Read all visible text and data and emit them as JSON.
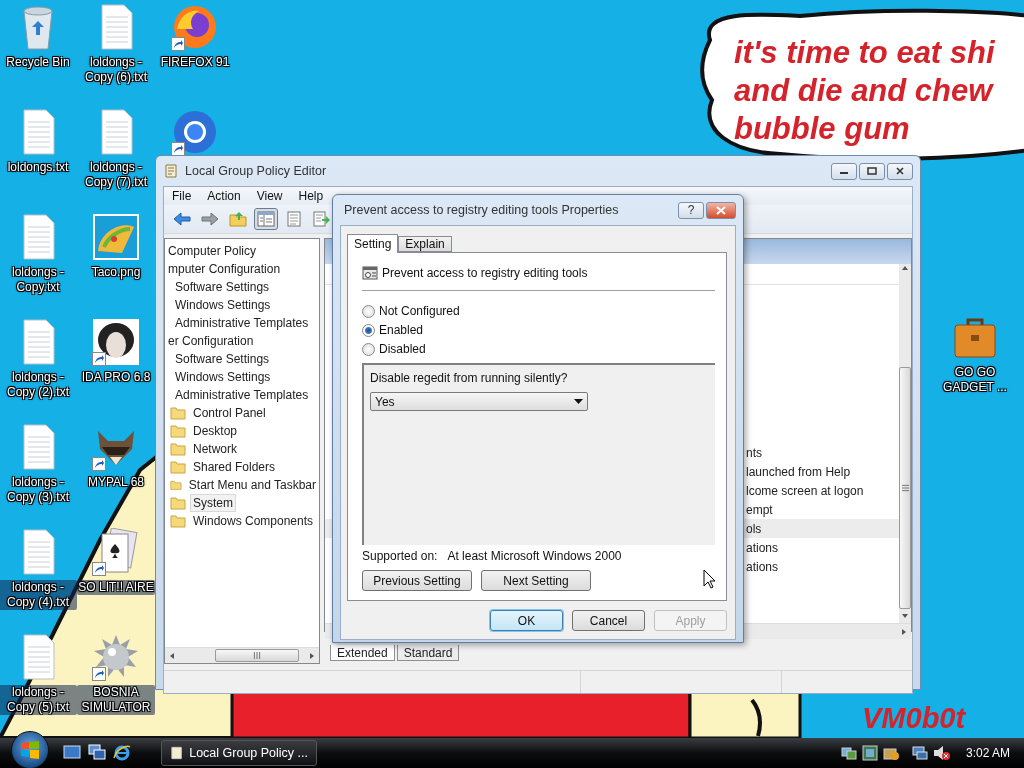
{
  "desktop_icons": [
    {
      "label": "Recycle Bin",
      "kind": "recycle",
      "shortcut": false
    },
    {
      "label": "loldongs.txt",
      "kind": "text",
      "shortcut": false
    },
    {
      "label": "loldongs - Copy.txt",
      "kind": "text",
      "shortcut": false
    },
    {
      "label": "loldongs - Copy (2).txt",
      "kind": "text",
      "shortcut": false
    },
    {
      "label": "loldongs - Copy (3).txt",
      "kind": "text",
      "shortcut": false
    },
    {
      "label": "loldongs - Copy (4).txt",
      "kind": "text",
      "shortcut": false
    },
    {
      "label": "loldongs - Copy (5).txt",
      "kind": "text",
      "shortcut": false
    },
    {
      "label": "loldongs - Copy (6).txt",
      "kind": "text",
      "shortcut": false
    },
    {
      "label": "loldongs - Copy (7).txt",
      "kind": "text",
      "shortcut": false
    },
    {
      "label": "Taco.png",
      "kind": "taco",
      "shortcut": false
    },
    {
      "label": "IDA PRO 6.8",
      "kind": "portrait",
      "shortcut": true
    },
    {
      "label": "MYPAL 68",
      "kind": "raccoon",
      "shortcut": true
    },
    {
      "label": "SO LIT!! AIRE",
      "kind": "cards",
      "shortcut": true
    },
    {
      "label": "BOSNIA SIMULATOR",
      "kind": "mine",
      "shortcut": true
    },
    {
      "label": "FIREFOX 91",
      "kind": "firefox",
      "shortcut": true
    },
    {
      "kind": "chrome",
      "shortcut": true
    },
    {
      "label": "GO GO GADGET ...",
      "kind": "briefcase",
      "shortcut": false
    }
  ],
  "wallpaper": {
    "speech_lines": [
      "it's time to eat shi",
      "and die and chew",
      "bubble gum"
    ],
    "signature": "VM0b0t"
  },
  "editor_window": {
    "title": "Local Group Policy Editor",
    "menu": [
      "File",
      "Action",
      "View",
      "Help"
    ],
    "toolbar": [
      {
        "kind": "back",
        "pressed": false
      },
      {
        "kind": "forward",
        "pressed": false
      },
      {
        "kind": "up",
        "pressed": false
      },
      {
        "kind": "tree",
        "pressed": true
      },
      {
        "kind": "properties",
        "pressed": false
      },
      {
        "kind": "export",
        "pressed": false
      }
    ],
    "tree": [
      {
        "label": "Computer Policy",
        "selected": false,
        "children": [
          {
            "label": "mputer Configuration",
            "selected": false,
            "children": [
              {
                "label": "Software Settings",
                "selected": false
              },
              {
                "label": "Windows Settings",
                "selected": false
              },
              {
                "label": "Administrative Templates",
                "selected": false
              }
            ]
          },
          {
            "label": "er Configuration",
            "selected": false,
            "children": [
              {
                "label": "Software Settings",
                "selected": false
              },
              {
                "label": "Windows Settings",
                "selected": false
              },
              {
                "label": "Administrative Templates",
                "selected": false,
                "children": [
                  {
                    "label": "Control Panel",
                    "kind": "folder",
                    "selected": false
                  },
                  {
                    "label": "Desktop",
                    "kind": "folder",
                    "selected": false
                  },
                  {
                    "label": "Network",
                    "kind": "folder",
                    "selected": false
                  },
                  {
                    "label": "Shared Folders",
                    "kind": "folder",
                    "selected": false
                  },
                  {
                    "label": "Start Menu and Taskbar",
                    "kind": "folder",
                    "selected": false
                  },
                  {
                    "label": "System",
                    "kind": "folder",
                    "selected": true
                  },
                  {
                    "label": "Windows Components",
                    "kind": "folder",
                    "selected": false
                  }
                ]
              }
            ]
          }
        ]
      }
    ],
    "detail_rows": [
      {
        "text": "nts",
        "selected": false
      },
      {
        "text": "launched from Help",
        "selected": false
      },
      {
        "text": "lcome screen at logon",
        "selected": false
      },
      {
        "text": "empt",
        "selected": false
      },
      {
        "text": "ols",
        "selected": true
      },
      {
        "text": "ations",
        "selected": false
      },
      {
        "text": "ations",
        "selected": false
      }
    ],
    "bottom_tabs": [
      {
        "label": "Extended",
        "selected": true
      },
      {
        "label": "Standard",
        "selected": false
      }
    ]
  },
  "dialog": {
    "title": "Prevent access to registry editing tools Properties",
    "help": "?",
    "tabs": [
      {
        "label": "Setting",
        "selected": true
      },
      {
        "label": "Explain",
        "selected": false
      }
    ],
    "policy_name": "Prevent access to registry editing tools",
    "options": [
      {
        "label": "Not Configured",
        "selected": false
      },
      {
        "label": "Enabled",
        "selected": true
      },
      {
        "label": "Disabled",
        "selected": false
      }
    ],
    "option_prompt": "Disable regedit from running silently?",
    "dropdown_value": "Yes",
    "supported_label": "Supported on:",
    "supported_value": "At least Microsoft Windows 2000",
    "nav_buttons": [
      "Previous Setting",
      "Next Setting"
    ],
    "buttons": [
      {
        "label": "OK",
        "default": true,
        "disabled": false
      },
      {
        "label": "Cancel",
        "default": false,
        "disabled": false
      },
      {
        "label": "Apply",
        "default": false,
        "disabled": true
      }
    ]
  },
  "taskbar": {
    "tasks": [
      {
        "label": "Local Group Policy ...",
        "selected": false
      }
    ],
    "clock": "3:02 AM"
  }
}
